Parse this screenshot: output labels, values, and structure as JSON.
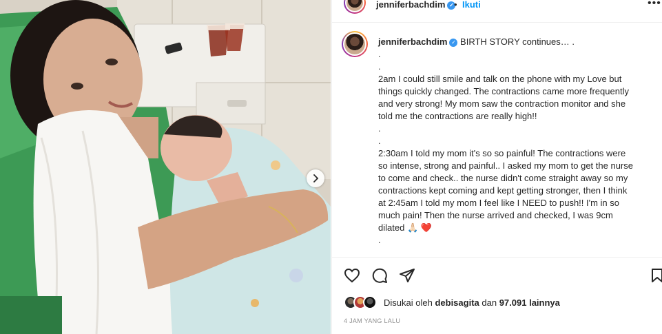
{
  "post": {
    "username": "jenniferbachdim",
    "separator": "•",
    "follow_label": "Ikuti",
    "more_label": "•••"
  },
  "caption": {
    "username": "jenniferbachdim",
    "lines": [
      "BIRTH STORY continues… .",
      ".",
      ".",
      "2am I could still smile and talk on the phone with my Love but",
      "things quickly changed. The contractions came more frequently",
      "and very strong! My mom saw the contraction monitor and she",
      "told me the contractions are really high!!",
      ".",
      ".",
      "2:30am I told my mom it's so so painful! The contractions were",
      "so intense, strong and painful.. I asked my mom to get the nurse",
      "to come and check.. the nurse didn't come straight away so my",
      "contractions kept coming and kept getting stronger, then I think",
      "at 2:45am I told my mom I feel like I NEED to push!! I'm in so",
      "much pain! Then the nurse arrived and checked, I was 9cm",
      "dilated",
      "."
    ],
    "emoji_after_dilated": "🙏🏻 ❤️"
  },
  "likes": {
    "prefix": "Disukai oleh",
    "user": "debisagita",
    "connector": "dan",
    "count": "97.091 lainnya"
  },
  "timestamp": "4 JAM YANG LALU",
  "colors": {
    "link_blue": "#0095f6",
    "verified_blue": "#3897f0",
    "heart_red": "#ed4956",
    "muted": "#8e8e8e"
  },
  "icons": {
    "like": "heart-outline-icon",
    "comment": "comment-bubble-icon",
    "share": "paper-plane-icon",
    "save": "bookmark-icon",
    "verified": "verified-badge-icon",
    "next": "chevron-right-icon"
  }
}
